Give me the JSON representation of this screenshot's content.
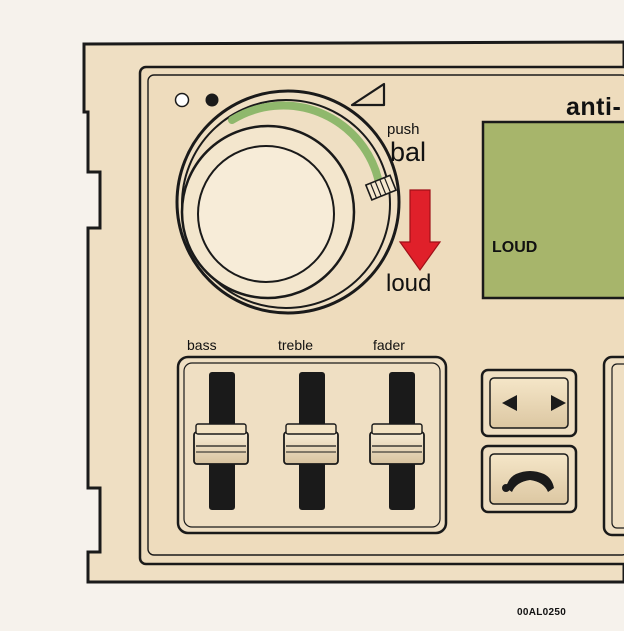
{
  "panel": {
    "title_fragment": "anti-",
    "display_text": "LOUD",
    "code": "00AL0250"
  },
  "volume_knob": {
    "push_label": "push",
    "bal_label": "bal",
    "loud_label": "loud"
  },
  "sliders": [
    {
      "label": "bass"
    },
    {
      "label": "treble"
    },
    {
      "label": "fader"
    }
  ],
  "buttons": {
    "seek_icon": "left-right-arrows-icon",
    "phone_icon": "phone-handset-icon"
  },
  "colors": {
    "panel": "#eedcbd",
    "display": "#a7b56b",
    "arrow": "#e0202a",
    "knob_ring": "#8fb86c",
    "slider_track": "#1a1a1a",
    "background": "#f6f2ec"
  }
}
